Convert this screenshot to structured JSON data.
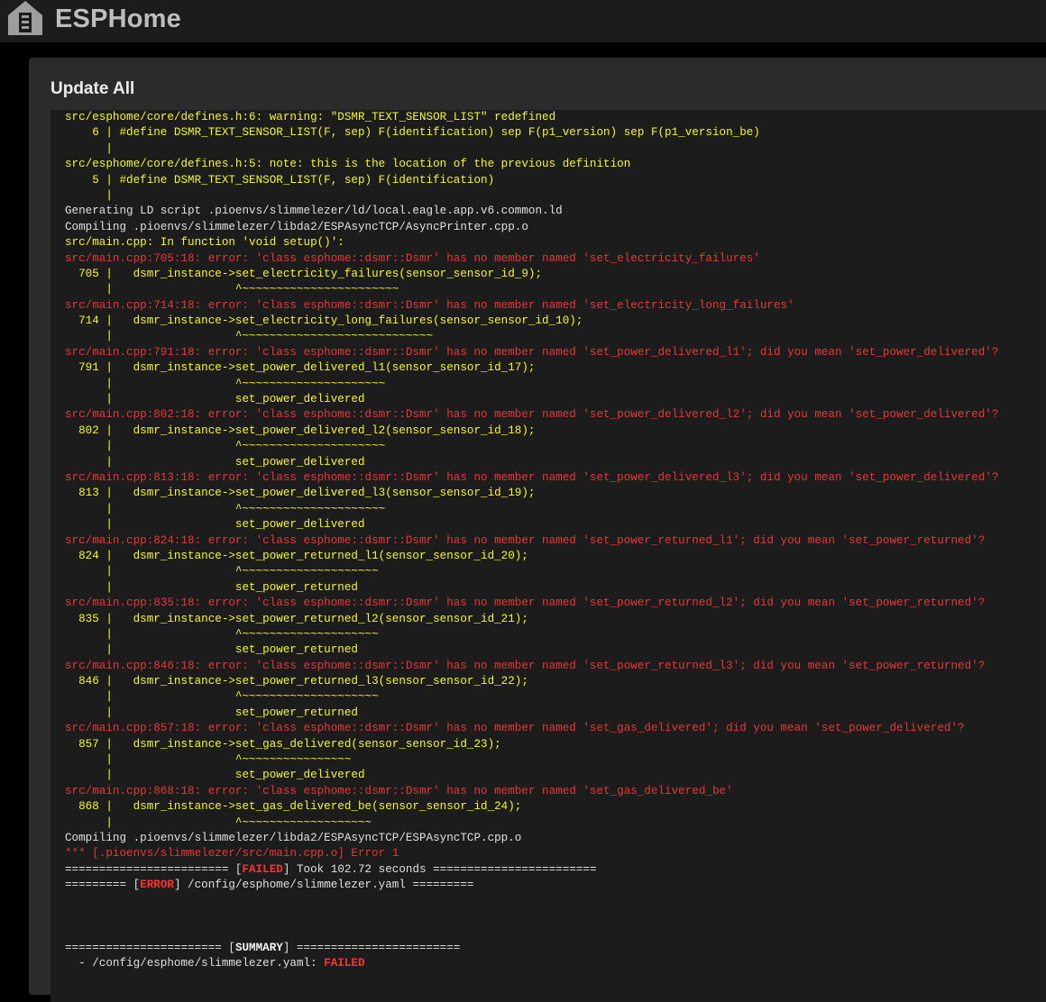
{
  "app": {
    "brand": "ESPHome",
    "logo_icon": "esphome-house-icon"
  },
  "dialog": {
    "title": "Update All"
  },
  "log": {
    "lines": [
      {
        "color": "yellow",
        "text": "src/esphome/core/defines.h:6: warning: \"DSMR_TEXT_SENSOR_LIST\" redefined"
      },
      {
        "color": "yellow",
        "text": "    6 | #define DSMR_TEXT_SENSOR_LIST(F, sep) F(identification) sep F(p1_version) sep F(p1_version_be)"
      },
      {
        "color": "yellow",
        "text": "      |"
      },
      {
        "color": "yellow",
        "text": "src/esphome/core/defines.h:5: note: this is the location of the previous definition"
      },
      {
        "color": "yellow",
        "text": "    5 | #define DSMR_TEXT_SENSOR_LIST(F, sep) F(identification)"
      },
      {
        "color": "yellow",
        "text": "      |"
      },
      {
        "color": "white",
        "text": "Generating LD script .pioenvs/slimmelezer/ld/local.eagle.app.v6.common.ld"
      },
      {
        "color": "white",
        "text": "Compiling .pioenvs/slimmelezer/libda2/ESPAsyncTCP/AsyncPrinter.cpp.o"
      },
      {
        "color": "yellow",
        "text": "src/main.cpp: In function 'void setup()':"
      },
      {
        "color": "red",
        "text": "src/main.cpp:705:18: error: 'class esphome::dsmr::Dsmr' has no member named 'set_electricity_failures'"
      },
      {
        "color": "yellow",
        "text": "  705 |   dsmr_instance->set_electricity_failures(sensor_sensor_id_9);"
      },
      {
        "color": "yellow",
        "text": "      |                  ^~~~~~~~~~~~~~~~~~~~~~~~"
      },
      {
        "color": "red",
        "text": "src/main.cpp:714:18: error: 'class esphome::dsmr::Dsmr' has no member named 'set_electricity_long_failures'"
      },
      {
        "color": "yellow",
        "text": "  714 |   dsmr_instance->set_electricity_long_failures(sensor_sensor_id_10);"
      },
      {
        "color": "yellow",
        "text": "      |                  ^~~~~~~~~~~~~~~~~~~~~~~~~~~~~"
      },
      {
        "color": "red",
        "text": "src/main.cpp:791:18: error: 'class esphome::dsmr::Dsmr' has no member named 'set_power_delivered_l1'; did you mean 'set_power_delivered'?"
      },
      {
        "color": "yellow",
        "text": "  791 |   dsmr_instance->set_power_delivered_l1(sensor_sensor_id_17);"
      },
      {
        "color": "yellow",
        "text": "      |                  ^~~~~~~~~~~~~~~~~~~~~~"
      },
      {
        "color": "yellow",
        "text": "      |                  set_power_delivered"
      },
      {
        "color": "red",
        "text": "src/main.cpp:802:18: error: 'class esphome::dsmr::Dsmr' has no member named 'set_power_delivered_l2'; did you mean 'set_power_delivered'?"
      },
      {
        "color": "yellow",
        "text": "  802 |   dsmr_instance->set_power_delivered_l2(sensor_sensor_id_18);"
      },
      {
        "color": "yellow",
        "text": "      |                  ^~~~~~~~~~~~~~~~~~~~~~"
      },
      {
        "color": "yellow",
        "text": "      |                  set_power_delivered"
      },
      {
        "color": "red",
        "text": "src/main.cpp:813:18: error: 'class esphome::dsmr::Dsmr' has no member named 'set_power_delivered_l3'; did you mean 'set_power_delivered'?"
      },
      {
        "color": "yellow",
        "text": "  813 |   dsmr_instance->set_power_delivered_l3(sensor_sensor_id_19);"
      },
      {
        "color": "yellow",
        "text": "      |                  ^~~~~~~~~~~~~~~~~~~~~~"
      },
      {
        "color": "yellow",
        "text": "      |                  set_power_delivered"
      },
      {
        "color": "red",
        "text": "src/main.cpp:824:18: error: 'class esphome::dsmr::Dsmr' has no member named 'set_power_returned_l1'; did you mean 'set_power_returned'?"
      },
      {
        "color": "yellow",
        "text": "  824 |   dsmr_instance->set_power_returned_l1(sensor_sensor_id_20);"
      },
      {
        "color": "yellow",
        "text": "      |                  ^~~~~~~~~~~~~~~~~~~~~"
      },
      {
        "color": "yellow",
        "text": "      |                  set_power_returned"
      },
      {
        "color": "red",
        "text": "src/main.cpp:835:18: error: 'class esphome::dsmr::Dsmr' has no member named 'set_power_returned_l2'; did you mean 'set_power_returned'?"
      },
      {
        "color": "yellow",
        "text": "  835 |   dsmr_instance->set_power_returned_l2(sensor_sensor_id_21);"
      },
      {
        "color": "yellow",
        "text": "      |                  ^~~~~~~~~~~~~~~~~~~~~"
      },
      {
        "color": "yellow",
        "text": "      |                  set_power_returned"
      },
      {
        "color": "red",
        "text": "src/main.cpp:846:18: error: 'class esphome::dsmr::Dsmr' has no member named 'set_power_returned_l3'; did you mean 'set_power_returned'?"
      },
      {
        "color": "yellow",
        "text": "  846 |   dsmr_instance->set_power_returned_l3(sensor_sensor_id_22);"
      },
      {
        "color": "yellow",
        "text": "      |                  ^~~~~~~~~~~~~~~~~~~~~"
      },
      {
        "color": "yellow",
        "text": "      |                  set_power_returned"
      },
      {
        "color": "red",
        "text": "src/main.cpp:857:18: error: 'class esphome::dsmr::Dsmr' has no member named 'set_gas_delivered'; did you mean 'set_power_delivered'?"
      },
      {
        "color": "yellow",
        "text": "  857 |   dsmr_instance->set_gas_delivered(sensor_sensor_id_23);"
      },
      {
        "color": "yellow",
        "text": "      |                  ^~~~~~~~~~~~~~~~~"
      },
      {
        "color": "yellow",
        "text": "      |                  set_power_delivered"
      },
      {
        "color": "red",
        "text": "src/main.cpp:868:18: error: 'class esphome::dsmr::Dsmr' has no member named 'set_gas_delivered_be'"
      },
      {
        "color": "yellow",
        "text": "  868 |   dsmr_instance->set_gas_delivered_be(sensor_sensor_id_24);"
      },
      {
        "color": "yellow",
        "text": "      |                  ^~~~~~~~~~~~~~~~~~~~"
      },
      {
        "color": "white",
        "text": "Compiling .pioenvs/slimmelezer/libda2/ESPAsyncTCP/ESPAsyncTCP.cpp.o"
      },
      {
        "color": "red",
        "text": "*** [.pioenvs/slimmelezer/src/main.cpp.o] Error 1"
      },
      {
        "color": "white",
        "parts": [
          {
            "style": "white",
            "text": "======================== ["
          },
          {
            "style": "bold-red",
            "text": "FAILED"
          },
          {
            "style": "white",
            "text": "] Took 102.72 seconds ========================"
          }
        ]
      },
      {
        "color": "white",
        "parts": [
          {
            "style": "white",
            "text": "========= ["
          },
          {
            "style": "bold-red",
            "text": "ERROR"
          },
          {
            "style": "white",
            "text": "] /config/esphome/slimmelezer.yaml ========="
          }
        ]
      },
      {
        "color": "white",
        "text": ""
      },
      {
        "color": "white",
        "text": ""
      },
      {
        "color": "white",
        "text": ""
      },
      {
        "color": "white",
        "parts": [
          {
            "style": "white",
            "text": "======================= ["
          },
          {
            "style": "bold-white",
            "text": "SUMMARY"
          },
          {
            "style": "white",
            "text": "] ========================"
          }
        ]
      },
      {
        "color": "white",
        "parts": [
          {
            "style": "white",
            "text": "  - /config/esphome/slimmelezer.yaml: "
          },
          {
            "style": "bold-red",
            "text": "FAILED"
          }
        ]
      }
    ]
  }
}
